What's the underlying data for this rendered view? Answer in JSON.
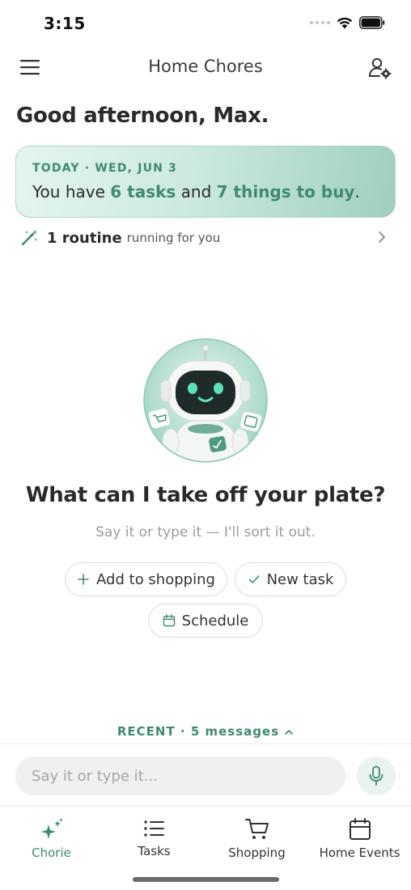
{
  "status_bar": {
    "time": "3:15"
  },
  "header": {
    "title": "Home Chores"
  },
  "greeting": "Good afternoon, Max.",
  "today_card": {
    "label": "TODAY · WED, JUN 3",
    "text_prefix": "You have ",
    "tasks_highlight": "6 tasks",
    "text_middle": " and ",
    "buy_highlight": "7 things to buy",
    "text_suffix": "."
  },
  "routine": {
    "count_label": "1 routine",
    "sub_label": "running for you"
  },
  "prompt": {
    "title": "What can I take off your plate?",
    "subtitle": "Say it or type it — I'll sort it out."
  },
  "chips": {
    "add_shopping": "Add to shopping",
    "new_task": "New task",
    "schedule": "Schedule"
  },
  "recent": {
    "label": "RECENT · 5 messages"
  },
  "input": {
    "placeholder": "Say it or type it..."
  },
  "nav": {
    "items": [
      {
        "label": "Chorie",
        "icon": "sparkle-icon",
        "active": true
      },
      {
        "label": "Tasks",
        "icon": "list-icon",
        "active": false
      },
      {
        "label": "Shopping",
        "icon": "cart-icon",
        "active": false
      },
      {
        "label": "Home Events",
        "icon": "calendar-icon",
        "active": false
      }
    ]
  },
  "colors": {
    "accent": "#3f8a70",
    "card_start": "#e4f5ee",
    "card_end": "#9fcfbd",
    "text": "#2b2b2b",
    "muted": "#9a9a9a"
  }
}
